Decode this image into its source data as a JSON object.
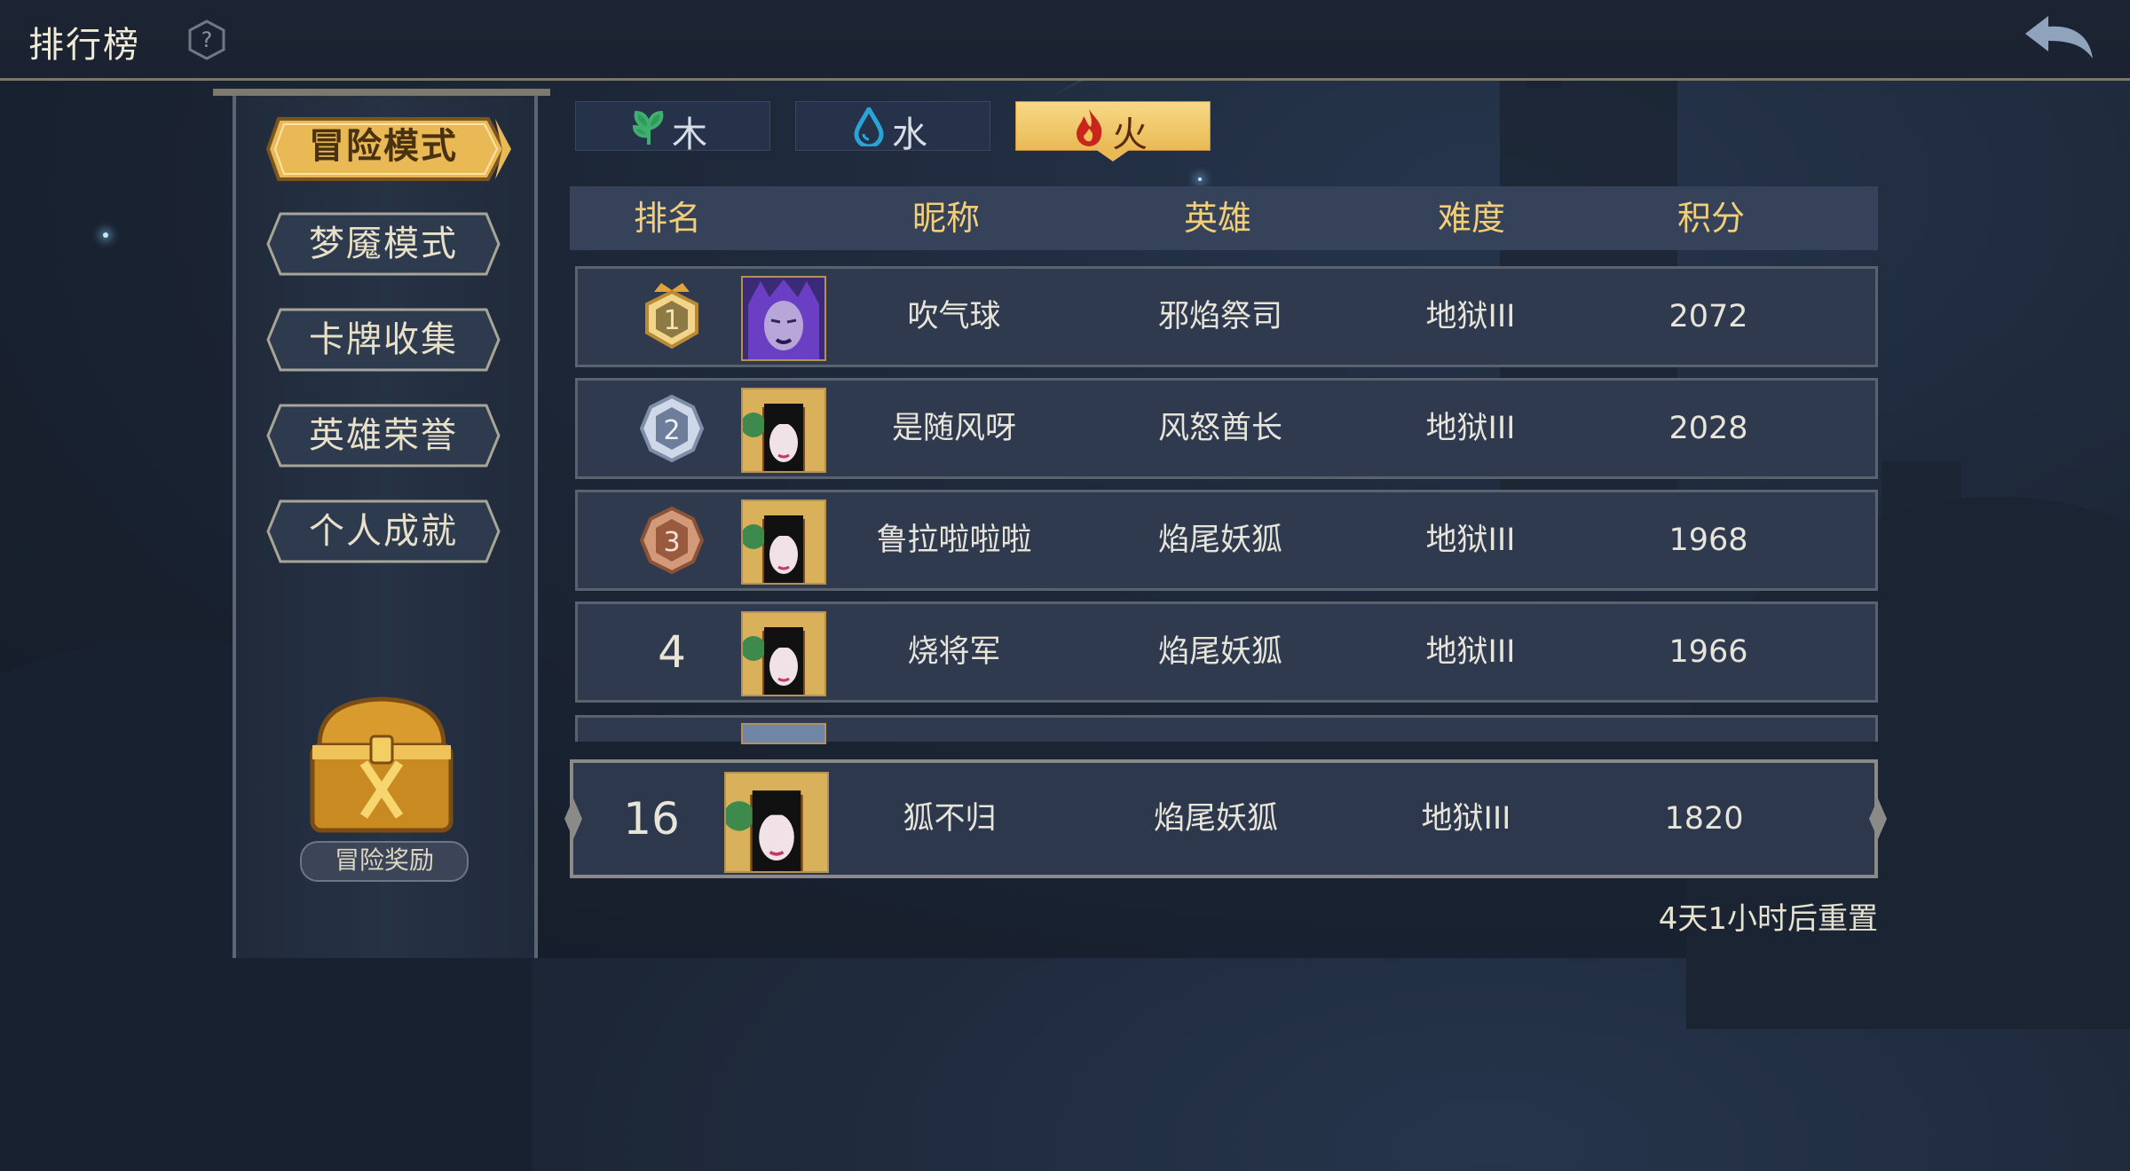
{
  "title": "排行榜",
  "icons": {
    "help": "help-icon",
    "back": "back-arrow-icon",
    "chest": "treasure-chest-icon"
  },
  "modes": [
    {
      "label": "冒险模式",
      "active": true
    },
    {
      "label": "梦魇模式",
      "active": false
    },
    {
      "label": "卡牌收集",
      "active": false
    },
    {
      "label": "英雄荣誉",
      "active": false
    },
    {
      "label": "个人成就",
      "active": false
    }
  ],
  "reward_label": "冒险奖励",
  "tabs": [
    {
      "label": "木",
      "icon": "leaf-icon",
      "active": false
    },
    {
      "label": "水",
      "icon": "water-drop-icon",
      "active": false
    },
    {
      "label": "火",
      "icon": "flame-icon",
      "active": true
    }
  ],
  "columns": [
    "排名",
    "昵称",
    "英雄",
    "难度",
    "积分"
  ],
  "rows": [
    {
      "rank": "1",
      "nickname": "吹气球",
      "hero": "邪焰祭司",
      "difficulty": "地狱III",
      "score": "2072"
    },
    {
      "rank": "2",
      "nickname": "是随风呀",
      "hero": "风怒酋长",
      "difficulty": "地狱III",
      "score": "2028"
    },
    {
      "rank": "3",
      "nickname": "鲁拉啦啦啦",
      "hero": "焰尾妖狐",
      "difficulty": "地狱III",
      "score": "1968"
    },
    {
      "rank": "4",
      "nickname": "烧将军",
      "hero": "焰尾妖狐",
      "difficulty": "地狱III",
      "score": "1966"
    }
  ],
  "my_row": {
    "rank": "16",
    "nickname": "狐不归",
    "hero": "焰尾妖狐",
    "difficulty": "地狱III",
    "score": "1820"
  },
  "reset_text": "4天1小时后重置",
  "colors": {
    "accent_gold": "#f1cf79",
    "active_tab": "#e9b955",
    "panel": "#2f3a4f"
  }
}
